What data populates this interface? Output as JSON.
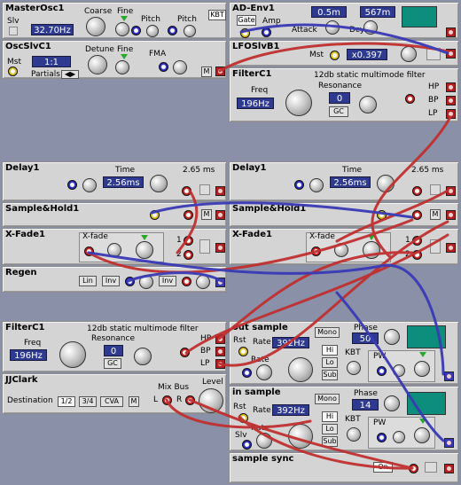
{
  "master_osc": {
    "title": "MasterOsc1",
    "slv": "Slv",
    "coarse": "Coarse",
    "fine": "Fine",
    "freq": "32.70Hz",
    "pitch1": "Pitch",
    "pitch2": "Pitch",
    "kbt": "KBT"
  },
  "osc_slv": {
    "title": "OscSlvC1",
    "detune": "Detune",
    "fine": "Fine",
    "fma": "FMA",
    "mst": "Mst",
    "ratio": "1:1",
    "partials": "Partials",
    "m": "M"
  },
  "ad_env": {
    "title": "AD-Env1",
    "gate": "Gate",
    "amp": "Amp",
    "attack": "Attack",
    "decay": "Dcy",
    "attack_val": "0.5m",
    "decay_val": "567m"
  },
  "lfo": {
    "title": "LFOSlvB1",
    "mst": "Mst",
    "val": "x0.397"
  },
  "filter_top": {
    "title": "FilterC1",
    "desc": "12db static multimode filter",
    "freq": "Freq",
    "freq_val": "196Hz",
    "res": "Resonance",
    "res_val": "0",
    "gc": "GC",
    "hp": "HP",
    "bp": "BP",
    "lp": "LP"
  },
  "delay_left": {
    "title": "Delay1",
    "time": "Time",
    "time_val": "2.56ms",
    "max": "2.65 ms"
  },
  "delay_right": {
    "title": "Delay1",
    "time": "Time",
    "time_val": "2.56ms",
    "max": "2.65 ms"
  },
  "sh_left": {
    "title": "Sample&Hold1",
    "m": "M"
  },
  "sh_right": {
    "title": "Sample&Hold1",
    "m": "M"
  },
  "xfade_left": {
    "title": "X-Fade1",
    "xfade": "X-fade",
    "one": "1",
    "two": "2"
  },
  "xfade_right": {
    "title": "X-Fade1",
    "xfade": "X-fade",
    "one": "1",
    "two": "2"
  },
  "regen": {
    "title": "Regen",
    "lin": "Lin",
    "inv1": "Inv",
    "inv2": "Inv"
  },
  "filter_bot": {
    "title": "FilterC1",
    "desc": "12db static multimode filter",
    "freq": "Freq",
    "freq_val": "196Hz",
    "res": "Resonance",
    "res_val": "0",
    "gc": "GC",
    "hp": "HP",
    "bp": "BP",
    "lp": "LP"
  },
  "jjclark": {
    "title": "JJClark",
    "dest": "Destination",
    "d1": "1/2",
    "d2": "3/4",
    "d3": "CVA",
    "m": "M",
    "mixbus": "Mix Bus",
    "level": "Level",
    "l": "L",
    "r": "R"
  },
  "out_sample": {
    "title": "out sample",
    "mono": "Mono",
    "phase": "Phase",
    "phase_val": "50",
    "rst": "Rst",
    "rate": "Rate",
    "rate_val": "392Hz",
    "rate2": "Rate",
    "hi": "Hi",
    "lo": "Lo",
    "sub": "Sub",
    "kbt": "KBT",
    "pw": "PW"
  },
  "in_sample": {
    "title": "in sample",
    "mono": "Mono",
    "phase": "Phase",
    "phase_val": "14",
    "rst": "Rst",
    "rate": "Rate",
    "rate_val": "392Hz",
    "slv": "Slv",
    "rate2": "Rate",
    "hi": "Hi",
    "lo": "Lo",
    "sub": "Sub",
    "kbt": "KBT",
    "pw": "PW"
  },
  "sample_sync": {
    "title": "sample sync",
    "on": "On"
  },
  "colors": {
    "background": "#8a90a8",
    "panel": "#d4d4d4",
    "display": "#2d3a8f",
    "scope": "#0d8d7b",
    "cable_red": "#c03030",
    "cable_blue": "#3a3ab5"
  }
}
